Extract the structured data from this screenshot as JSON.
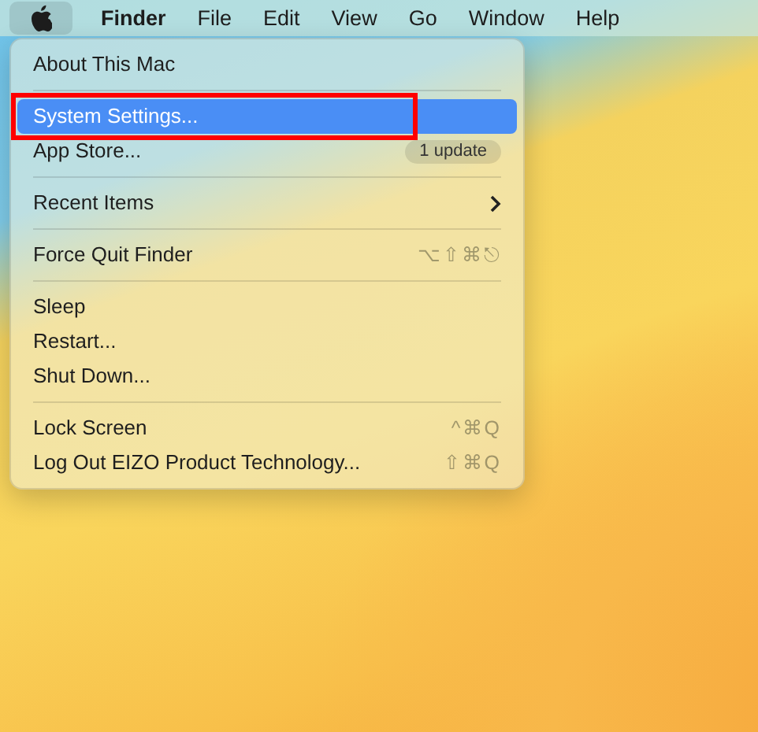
{
  "menu_bar": {
    "apple_menu": {
      "selected": true
    },
    "items": [
      {
        "label": "Finder",
        "kind": "app"
      },
      {
        "label": "File",
        "kind": "menu"
      },
      {
        "label": "Edit",
        "kind": "menu"
      },
      {
        "label": "View",
        "kind": "menu"
      },
      {
        "label": "Go",
        "kind": "menu"
      },
      {
        "label": "Window",
        "kind": "menu"
      },
      {
        "label": "Help",
        "kind": "menu"
      }
    ]
  },
  "apple_menu": {
    "groups": [
      [
        {
          "label": "About This Mac",
          "selected": false
        }
      ],
      [
        {
          "label": "System Settings...",
          "selected": true,
          "annotated": true
        },
        {
          "label": "App Store...",
          "selected": false,
          "badge": "1 update"
        }
      ],
      [
        {
          "label": "Recent Items",
          "selected": false,
          "submenu": true
        }
      ],
      [
        {
          "label": "Force Quit Finder",
          "selected": false,
          "shortcut": "⌥⇧⌘⎋"
        }
      ],
      [
        {
          "label": "Sleep",
          "selected": false
        },
        {
          "label": "Restart...",
          "selected": false
        },
        {
          "label": "Shut Down...",
          "selected": false
        }
      ],
      [
        {
          "label": "Lock Screen",
          "selected": false,
          "shortcut": "^⌘Q"
        },
        {
          "label": "Log Out EIZO Product Technology...",
          "selected": false,
          "shortcut": "⇧⌘Q"
        }
      ]
    ]
  }
}
